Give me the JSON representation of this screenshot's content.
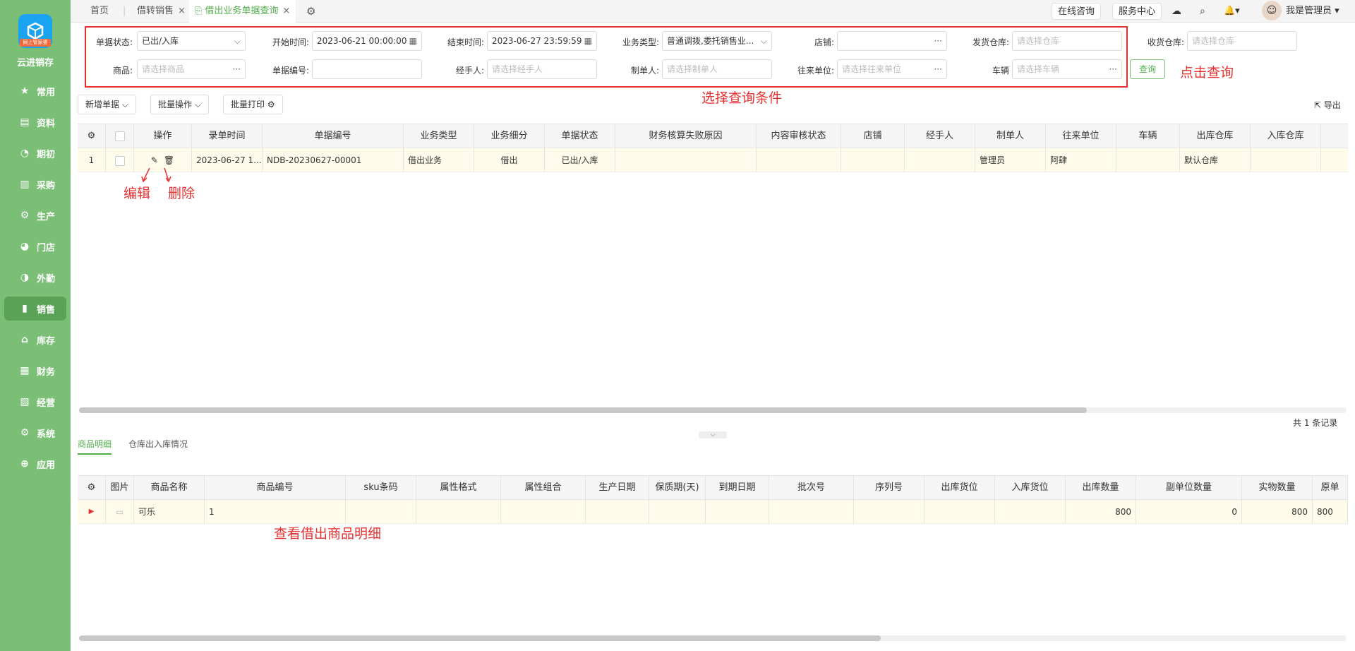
{
  "sidebar": {
    "logo_badge": "网上管家婆",
    "app_name": "云进销存",
    "items": [
      {
        "label": "常用",
        "icon": "★"
      },
      {
        "label": "资料",
        "icon": "▤"
      },
      {
        "label": "期初",
        "icon": "◔"
      },
      {
        "label": "采购",
        "icon": "▥"
      },
      {
        "label": "生产",
        "icon": "⚙"
      },
      {
        "label": "门店",
        "icon": "◕"
      },
      {
        "label": "外勤",
        "icon": "◑"
      },
      {
        "label": "销售",
        "icon": "▮"
      },
      {
        "label": "库存",
        "icon": "⌂"
      },
      {
        "label": "财务",
        "icon": "▦"
      },
      {
        "label": "经营",
        "icon": "▧"
      },
      {
        "label": "系统",
        "icon": "⚙"
      },
      {
        "label": "应用",
        "icon": "⊕"
      }
    ]
  },
  "tabs": {
    "home": "首页",
    "t1": "借转销售",
    "t2": "借出业务单据查询",
    "close": "×"
  },
  "topright": {
    "consult": "在线咨询",
    "service": "服务中心",
    "user": "我是管理员"
  },
  "filters": {
    "status_label": "单据状态:",
    "status_value": "已出/入库",
    "start_label": "开始时间:",
    "start_value": "2023-06-21 00:00:00",
    "end_label": "结束时间:",
    "end_value": "2023-06-27 23:59:59",
    "biztype_label": "业务类型:",
    "biztype_value": "普通调拨,委托销售业...",
    "shop_label": "店铺:",
    "shop_value": "",
    "outwh_label": "发货仓库:",
    "outwh_ph": "请选择仓库",
    "inwh_label": "收货仓库:",
    "inwh_ph": "请选择仓库",
    "goods_label": "商品:",
    "goods_ph": "请选择商品",
    "billno_label": "单据编号:",
    "billno_value": "",
    "handler_label": "经手人:",
    "handler_ph": "请选择经手人",
    "maker_label": "制单人:",
    "maker_ph": "请选择制单人",
    "partner_label": "往来单位:",
    "partner_ph": "请选择往来单位",
    "vehicle_label": "车辆",
    "vehicle_ph": "请选择车辆",
    "query_btn": "查询",
    "dots": "···"
  },
  "annotations": {
    "click_query": "点击查询",
    "select_conditions": "选择查询条件",
    "edit": "编辑",
    "delete": "删除",
    "view_detail": "查看借出商品明细"
  },
  "toolbar": {
    "new_bill": "新增单据",
    "batch_ops": "批量操作",
    "batch_print": "批量打印",
    "export": "导出"
  },
  "main_table": {
    "headers": [
      "操作",
      "录单时间",
      "单据编号",
      "业务类型",
      "业务细分",
      "单据状态",
      "财务核算失败原因",
      "内容审核状态",
      "店铺",
      "经手人",
      "制单人",
      "往来单位",
      "车辆",
      "出库仓库",
      "入库仓库"
    ],
    "row": {
      "index": "1",
      "time": "2023-06-27 1...",
      "billno": "NDB-20230627-00001",
      "biztype": "借出业务",
      "subtype": "借出",
      "status": "已出/入库",
      "fail": "",
      "audit": "",
      "shop": "",
      "handler": "",
      "maker": "管理员",
      "partner": "阿肆",
      "vehicle": "",
      "outwh": "默认仓库",
      "inwh": ""
    },
    "summary": "共 1 条记录"
  },
  "subtabs": {
    "detail": "商品明细",
    "warehouse": "仓库出入库情况"
  },
  "detail_table": {
    "headers": [
      "图片",
      "商品名称",
      "商品编号",
      "sku条码",
      "属性格式",
      "属性组合",
      "生产日期",
      "保质期(天)",
      "到期日期",
      "批次号",
      "序列号",
      "出库货位",
      "入库货位",
      "出库数量",
      "副单位数量",
      "实物数量",
      "原单"
    ],
    "row": {
      "name": "可乐",
      "code": "1",
      "out_qty": "800",
      "sub_qty": "0",
      "real_qty": "800",
      "orig": "800"
    }
  }
}
